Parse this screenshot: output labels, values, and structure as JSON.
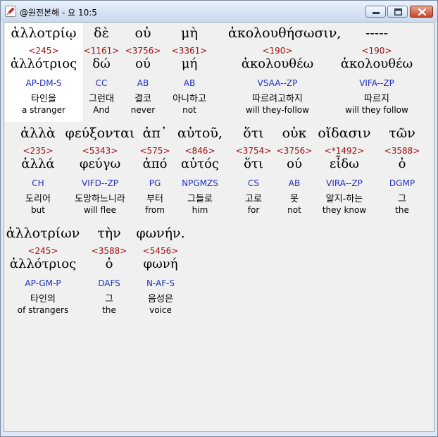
{
  "window": {
    "title": "@원전본해 - 요 10:5",
    "icon": "app-pen-icon",
    "controls": [
      "minimize-icon",
      "maximize-icon",
      "close-icon"
    ]
  },
  "words": [
    {
      "greek": "ἀλλοτρίῳ",
      "number": "<245>",
      "lexeme": "ἀλλότριος",
      "parsing": "AP-DM-S",
      "korean": "타인을",
      "english": "a stranger"
    },
    {
      "greek": "δὲ",
      "number": "<1161>",
      "lexeme": "δώ",
      "parsing": "CC",
      "korean": "그런대",
      "english": "And"
    },
    {
      "greek": "οὐ",
      "number": "<3756>",
      "lexeme": "ού",
      "parsing": "AB",
      "korean": "결코",
      "english": "never"
    },
    {
      "greek": "μὴ",
      "number": "<3361>",
      "lexeme": "μή",
      "parsing": "AB",
      "korean": "아니하고",
      "english": "not"
    },
    {
      "greek": "ἀκολουθήσωσιν,",
      "number": "<190>",
      "lexeme": "ἀκολουθέω",
      "parsing": "VSAA--ZP",
      "korean": "따르려고하지",
      "english": "will they-follow"
    },
    {
      "greek": "-----",
      "number": "<190>",
      "lexeme": "ἀκολουθέω",
      "parsing": "VIFA--ZP",
      "korean": "따르지",
      "english": "will they follow"
    },
    {
      "greek": "ἀλλὰ",
      "number": "<235>",
      "lexeme": "ἀλλά",
      "parsing": "CH",
      "korean": "도리어",
      "english": "but"
    },
    {
      "greek": "φεύξονται",
      "number": "<5343>",
      "lexeme": "φεύγω",
      "parsing": "VIFD--ZP",
      "korean": "도망하느니라",
      "english": "will flee"
    },
    {
      "greek": "ἀπ᾽",
      "number": "<575>",
      "lexeme": "ἀπό",
      "parsing": "PG",
      "korean": "부터",
      "english": "from"
    },
    {
      "greek": "αὐτοῦ,",
      "number": "<846>",
      "lexeme": "αὐτός",
      "parsing": "NPGMZS",
      "korean": "그들로",
      "english": "him"
    },
    {
      "greek": "ὅτι",
      "number": "<3754>",
      "lexeme": "ὅτι",
      "parsing": "CS",
      "korean": "고로",
      "english": "for"
    },
    {
      "greek": "οὐκ",
      "number": "<3756>",
      "lexeme": "ού",
      "parsing": "AB",
      "korean": "못",
      "english": "not"
    },
    {
      "greek": "οἴδασιν",
      "number": "<*1492>",
      "lexeme": "εἶδω",
      "parsing": "VIRA--ZP",
      "korean": "알지-하는",
      "english": "they know"
    },
    {
      "greek": "τῶν",
      "number": "<3588>",
      "lexeme": "ὁ",
      "parsing": "DGMP",
      "korean": "그",
      "english": "the"
    },
    {
      "greek": "ἀλλοτρίων",
      "number": "<245>",
      "lexeme": "ἀλλότριος",
      "parsing": "AP-GM-P",
      "korean": "타인의",
      "english": "of strangers"
    },
    {
      "greek": "τὴν",
      "number": "<3588>",
      "lexeme": "ὁ",
      "parsing": "DAFS",
      "korean": "그",
      "english": "the"
    },
    {
      "greek": "φωνήν.",
      "number": "<5456>",
      "lexeme": "φωνή",
      "parsing": "N-AF-S",
      "korean": "음성은",
      "english": "voice"
    }
  ]
}
